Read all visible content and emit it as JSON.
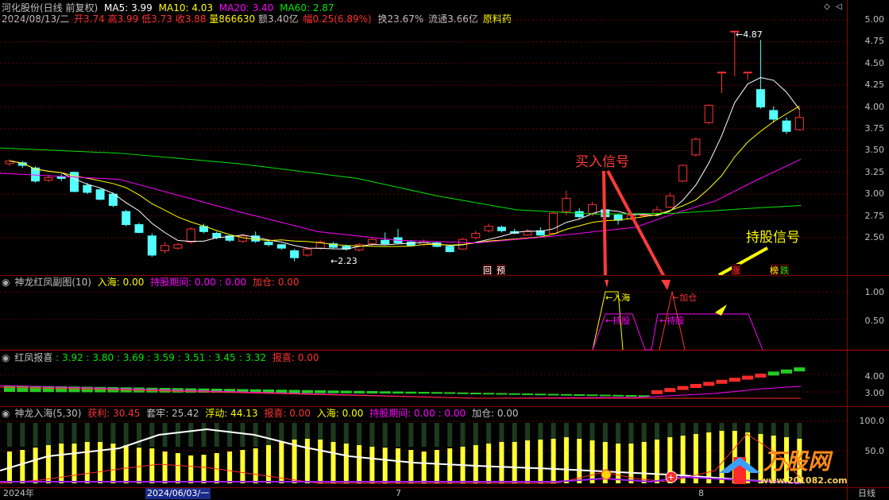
{
  "header": {
    "title": "河化股份(日线 前复权)",
    "ma5": "MA5: 3.99",
    "ma10": "MA10: 4.03",
    "ma20": "MA20: 3.40",
    "ma60": "MA60: 2.87",
    "date": "2024/08/13/二",
    "open": "开3.74",
    "high": "高3.99",
    "low": "低3.73",
    "close": "收3.88",
    "volume": "量866630",
    "amount": "额3.40亿",
    "change": "幅0.25(6.89%)",
    "turnover": "换23.67%",
    "float": "流通3.66亿",
    "sector": "原料药"
  },
  "colors": {
    "up": "#ff3232",
    "down": "#54ffff",
    "ma5": "#ffffff",
    "ma10": "#ffff00",
    "ma20": "#ff00ff",
    "ma60": "#00e600",
    "grid": "#8b0000"
  },
  "main_chart": {
    "yaxis": [
      "5.00",
      "4.75",
      "4.50",
      "4.25",
      "4.00",
      "3.75",
      "3.50",
      "3.25",
      "3.00",
      "2.75",
      "2.50"
    ],
    "annotation_high": "4.87",
    "annotation_low": "2.23",
    "tag_hui": "回",
    "tag_yu": "预",
    "tag_zhang": "涨",
    "tag_bang": "榜",
    "tag_die": "跌",
    "buy_signal": "买入信号",
    "hold_signal": "持股信号"
  },
  "pane2": {
    "name": "神龙红凤副图(10)",
    "v1": "入海: 0.00",
    "v2": "持股期间: 0.00 : 0.00",
    "v3": "加仓: 0.00",
    "yaxis": [
      "1.00",
      "0.50"
    ],
    "label_ruhai": "入海",
    "label_chigu": "持股",
    "label_jiacang": "加仓",
    "label_chigu2": "持股"
  },
  "pane3": {
    "name": "红凤报喜",
    "vals": ": 3.92 : 3.80 : 3.69 : 3.59 : 3.51 : 3.45 : 3.32",
    "baoxi": "报喜: 0.00",
    "yaxis": [
      "4.00",
      "3.00"
    ]
  },
  "pane4": {
    "name": "神龙入海(5,30)",
    "huoli": "获利: 30.45",
    "taolao": "套牢: 25.42",
    "fudong": "浮动: 44.13",
    "baoxi": "报喜: 0.00",
    "ruhai": "入海: 0.00",
    "chigu": "持股期间: 0.00 : 0.00",
    "jiacang": "加仓: 0.00",
    "yaxis": [
      "100.0",
      "50.0"
    ]
  },
  "bottom": {
    "year": "2024年",
    "date": "2024/06/03/一",
    "m7": "7",
    "m8": "8",
    "period": "日线"
  },
  "watermark": {
    "brand": "万股网",
    "url": "www.201082.com"
  }
}
